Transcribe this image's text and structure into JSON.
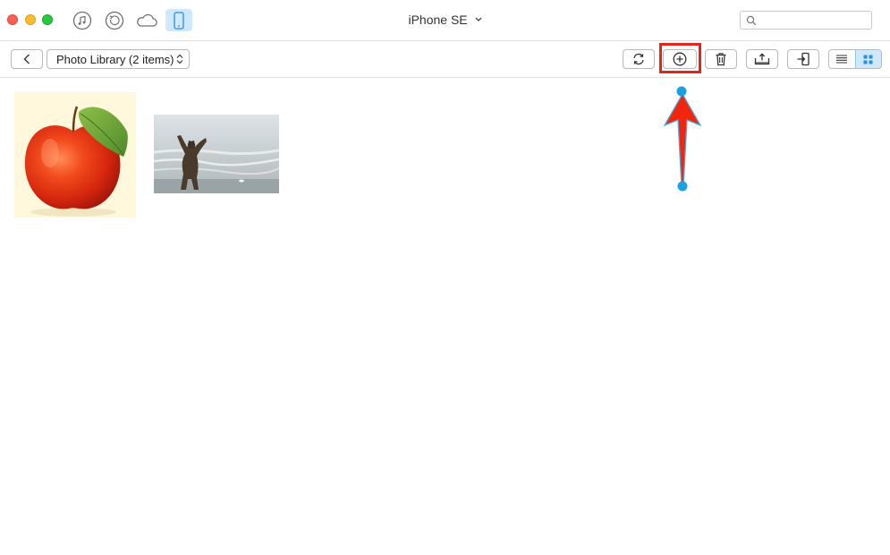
{
  "window": {
    "title": "iPhone SE"
  },
  "modes": [
    {
      "name": "music-mode",
      "icon": "music-note-icon"
    },
    {
      "name": "restore-mode",
      "icon": "history-icon"
    },
    {
      "name": "icloud-mode",
      "icon": "cloud-icon"
    },
    {
      "name": "device-mode",
      "icon": "iphone-icon",
      "active": true
    }
  ],
  "search": {
    "placeholder": "",
    "value": ""
  },
  "toolbar": {
    "album_select": "Photo Library (2 items)",
    "buttons": [
      "back",
      "refresh",
      "add",
      "delete",
      "export-to-computer",
      "send-to-device",
      "list-view",
      "grid-view"
    ],
    "active_view": "grid"
  },
  "photos": [
    {
      "subject": "red apple with green leaf"
    },
    {
      "subject": "bear standing on beach"
    }
  ],
  "annotation": {
    "highlight": "add-button",
    "arrow_color": "#e3261b",
    "handle_color": "#1ba1e2"
  },
  "colors": {
    "accent": "#cfe8fb",
    "highlight": "#e3261b",
    "close": "#fc5f57",
    "minimize": "#fdbc2e",
    "maximize": "#28c840"
  }
}
